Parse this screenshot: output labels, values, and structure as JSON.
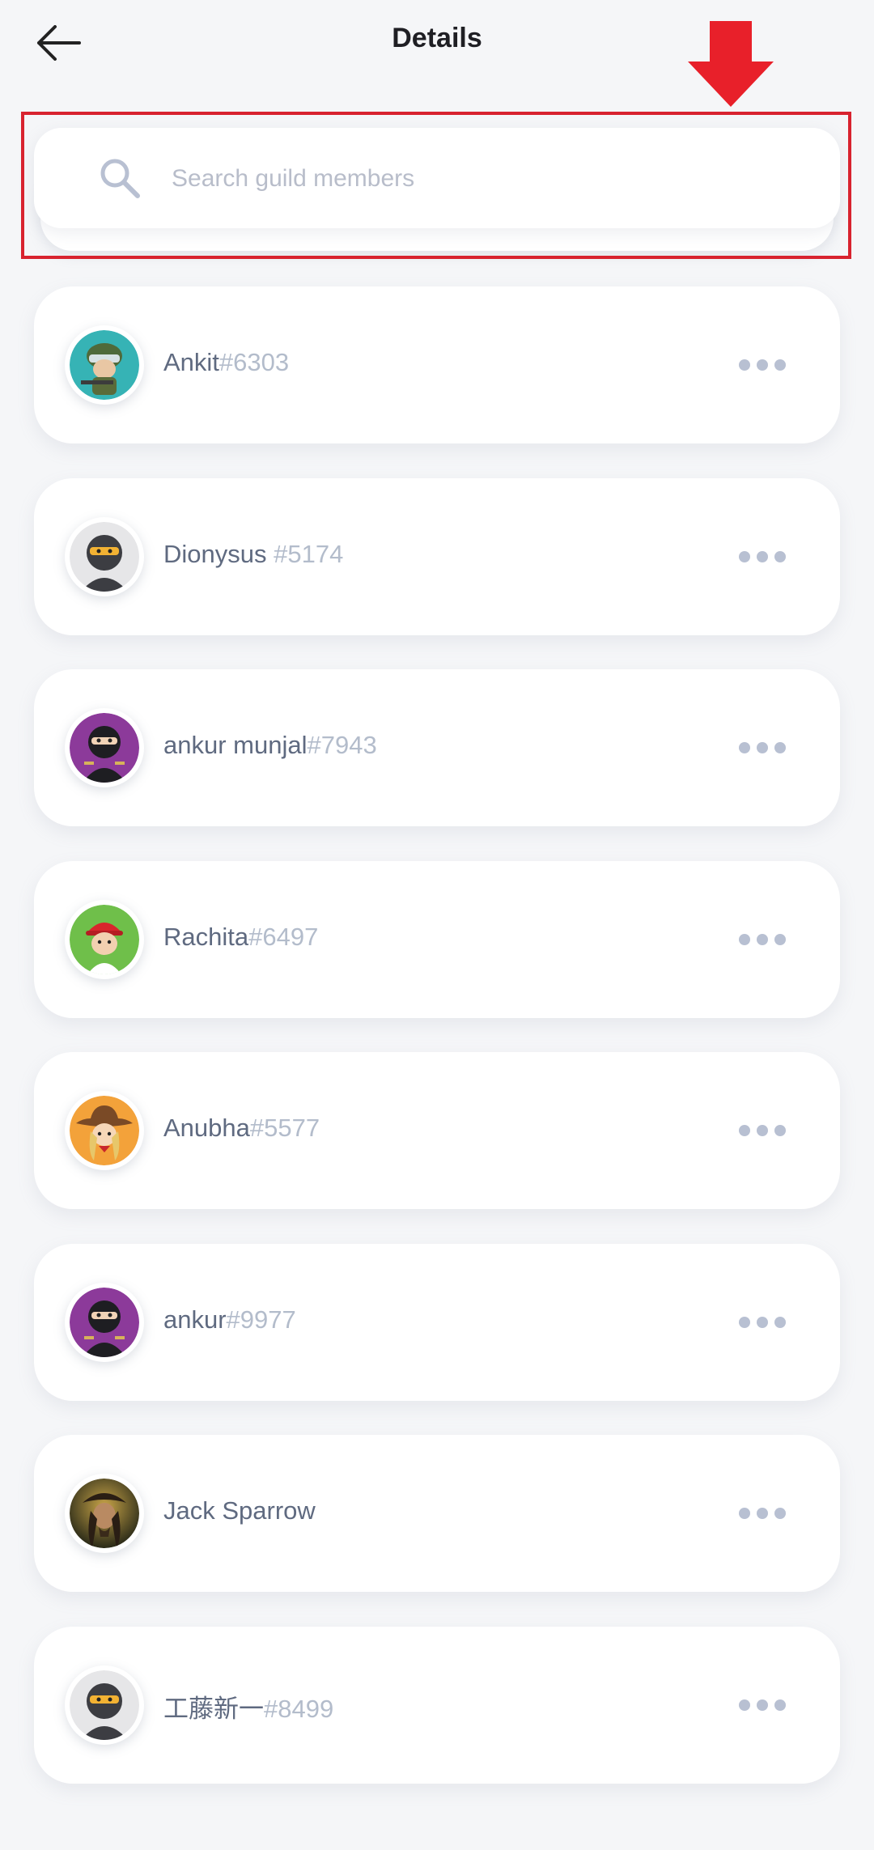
{
  "header": {
    "title": "Details",
    "back_icon": "arrow-left-icon"
  },
  "search": {
    "placeholder": "Search guild members",
    "value": "",
    "icon": "search-icon"
  },
  "annotation": {
    "arrow_color": "#e8202a",
    "box_color": "#d8232f"
  },
  "members": [
    {
      "name": "Ankit",
      "tag": "#6303",
      "avatar": "soldier-avatar"
    },
    {
      "name": "Dionysus ",
      "tag": "#5174",
      "avatar": "gray-ninja-avatar"
    },
    {
      "name": "ankur munjal",
      "tag": "#7943",
      "avatar": "purple-ninja-avatar"
    },
    {
      "name": "Rachita",
      "tag": "#6497",
      "avatar": "red-cap-avatar"
    },
    {
      "name": "Anubha",
      "tag": "#5577",
      "avatar": "cowgirl-avatar"
    },
    {
      "name": "ankur",
      "tag": "#9977",
      "avatar": "purple-ninja-avatar"
    },
    {
      "name": "Jack Sparrow",
      "tag": "",
      "avatar": "photo-avatar"
    },
    {
      "name": "工藤新一",
      "tag": "#8499",
      "avatar": "gray-ninja-avatar"
    }
  ],
  "more_icon": "more-dots-icon",
  "colors": {
    "background": "#f5f6f8",
    "card": "#ffffff",
    "name": "#5f6a80",
    "tag": "#b3bccb",
    "dots": "#b8c0d2"
  }
}
